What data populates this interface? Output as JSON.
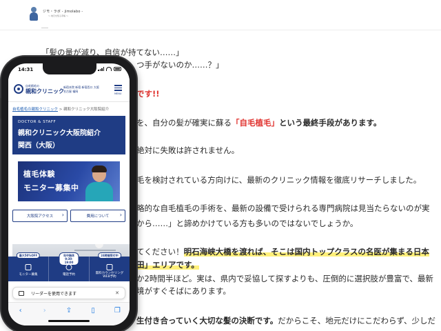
{
  "site": {
    "logo_title": "ジモ・ラボ - jimolabo -",
    "logo_sub": "〜 地元を知る手帳 〜"
  },
  "article": {
    "lines": [
      {
        "segments": [
          {
            "text": "「髪の量が減り、自信が持てない……」",
            "style": "plain"
          }
        ]
      },
      {
        "segments": [
          {
            "text": "つ手がないのか……？」",
            "style": "plain"
          }
        ]
      },
      {
        "segments": [
          {
            "text": "です!!",
            "style": "red"
          }
        ]
      },
      {
        "segments": [
          {
            "text": "を、自分の髪が確実に蘇る",
            "style": "plain"
          },
          {
            "text": "「自毛植毛」",
            "style": "red"
          },
          {
            "text": "という最終手段があります。",
            "style": "bold"
          }
        ]
      },
      {
        "segments": [
          {
            "text": "絶対に失敗は許されません。",
            "style": "plain"
          }
        ]
      },
      {
        "segments": [
          {
            "text": "毛を検討されている方向けに、最新のクリニック情報を徹底リサーチしました。",
            "style": "plain"
          }
        ]
      },
      {
        "segments": [
          {
            "text": "略的な自毛植毛の手術を、最新の設備で受けられる専門病院は見当たらないのが実",
            "style": "plain"
          }
        ]
      },
      {
        "segments": [
          {
            "text": "から……」と諦めかけている方も多いのではないでしょうか。",
            "style": "plain"
          }
        ]
      },
      {
        "segments": [
          {
            "text": "てください！",
            "style": "plain"
          },
          {
            "text": "明石海峡大橋を渡れば、そこは国内トップクラスの名医が集まる日本",
            "style": "hl"
          }
        ]
      },
      {
        "segments": [
          {
            "text": "田」エリアです。",
            "style": "hl"
          }
        ]
      },
      {
        "segments": [
          {
            "text": "か2時間半ほど。実は、県内で妥協して探すよりも、圧倒的に選択肢が豊富で、最新",
            "style": "plain"
          }
        ]
      },
      {
        "segments": [
          {
            "text": "境がすぐそばにあります。",
            "style": "plain"
          }
        ]
      },
      {
        "segments": [
          {
            "text": "生付き合っていく大切な髪の決断です。",
            "style": "bold"
          },
          {
            "text": "だからこそ、地元だけにこだわらず、少しだ",
            "style": "plain"
          }
        ]
      }
    ]
  },
  "phone": {
    "status_time": "14:31",
    "clinic": {
      "sub": "自毛植毛の",
      "name": "親和クリニック",
      "locations": "新宿本院 新宿 新宿西口 大阪 名古屋 福岡",
      "menu_label": "MENU"
    },
    "breadcrumb": {
      "link": "自毛植毛の親和クリニック",
      "separator": " > ",
      "current": "親和クリニック大阪院紹介"
    },
    "title": {
      "en": "DOCTOR & STAFF",
      "line1": "親和クリニック大阪院紹介",
      "line2": "関西（大阪）"
    },
    "banner": {
      "line1": "植毛体験",
      "line2": "モニター募集中"
    },
    "buttons": {
      "access": "大阪院アクセス",
      "fees": "費用について"
    },
    "cta": [
      {
        "pill": "最大50%OFF",
        "label": "モニター募集",
        "icon": "monitor-icon"
      },
      {
        "pill": "年中無休\n9:30-19:00",
        "label": "電話予約",
        "icon": "phone-icon"
      },
      {
        "pill": "24時間受付中",
        "label": "無料カウンセリング\nWEB予約",
        "icon": "calendar-icon"
      }
    ],
    "reader_text": "リーダーを使用できます",
    "safari": [
      "back-icon",
      "forward-icon",
      "share-icon",
      "bookmarks-icon",
      "tabs-icon"
    ]
  },
  "colors": {
    "brand_navy": "#1f3c84",
    "accent_red": "#e0322e",
    "highlight_yellow": "#fff07a",
    "ios_blue": "#1f7ae0"
  }
}
